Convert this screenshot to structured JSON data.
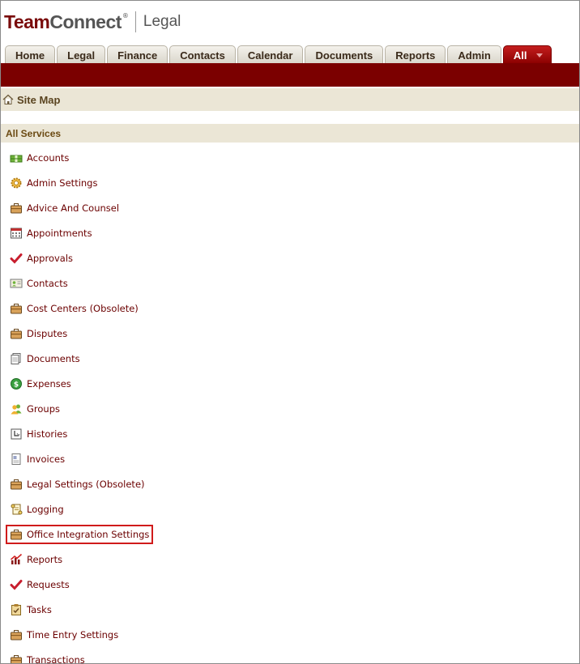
{
  "logo": {
    "brand_team": "Team",
    "brand_connect": "Connect",
    "registered": "®",
    "product": "Legal"
  },
  "tabs": [
    {
      "label": "Home"
    },
    {
      "label": "Legal"
    },
    {
      "label": "Finance"
    },
    {
      "label": "Contacts"
    },
    {
      "label": "Calendar"
    },
    {
      "label": "Documents"
    },
    {
      "label": "Reports"
    },
    {
      "label": "Admin"
    },
    {
      "label": "All",
      "active": true
    }
  ],
  "page_title": "Site Map",
  "section_title": "All Services",
  "services": [
    {
      "label": "Accounts",
      "icon": "accounts-icon"
    },
    {
      "label": "Admin Settings",
      "icon": "gear-icon"
    },
    {
      "label": "Advice And Counsel",
      "icon": "briefcase-icon"
    },
    {
      "label": "Appointments",
      "icon": "calendar-icon"
    },
    {
      "label": "Approvals",
      "icon": "checkmark-icon"
    },
    {
      "label": "Contacts",
      "icon": "contact-card-icon"
    },
    {
      "label": "Cost Centers (Obsolete)",
      "icon": "briefcase-icon"
    },
    {
      "label": "Disputes",
      "icon": "briefcase-icon"
    },
    {
      "label": "Documents",
      "icon": "document-icon"
    },
    {
      "label": "Expenses",
      "icon": "dollar-coin-icon"
    },
    {
      "label": "Groups",
      "icon": "group-icon"
    },
    {
      "label": "Histories",
      "icon": "history-icon"
    },
    {
      "label": "Invoices",
      "icon": "invoice-icon"
    },
    {
      "label": "Legal Settings (Obsolete)",
      "icon": "briefcase-icon"
    },
    {
      "label": "Logging",
      "icon": "scroll-icon"
    },
    {
      "label": "Office Integration Settings",
      "icon": "briefcase-icon",
      "highlighted": true
    },
    {
      "label": "Reports",
      "icon": "report-chart-icon"
    },
    {
      "label": "Requests",
      "icon": "checkmark-icon"
    },
    {
      "label": "Tasks",
      "icon": "task-clipboard-icon"
    },
    {
      "label": "Time Entry Settings",
      "icon": "briefcase-icon"
    },
    {
      "label": "Transactions",
      "icon": "briefcase-icon"
    }
  ],
  "colors": {
    "brand_red": "#7b0000",
    "link": "#6b0000",
    "header_bg": "#ebe6d6",
    "highlight_border": "#d01b1b"
  }
}
